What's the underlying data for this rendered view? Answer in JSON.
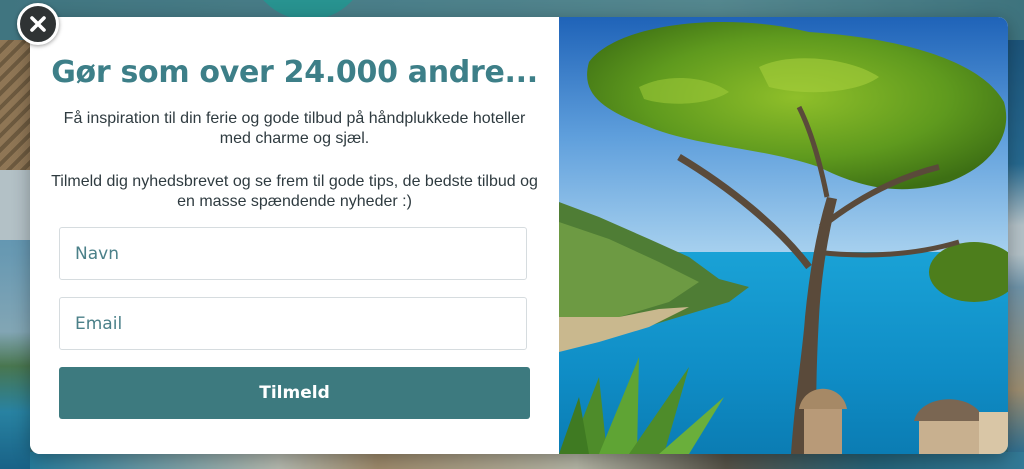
{
  "popup": {
    "title": "Gør som over 24.000 andre...",
    "paragraph_1": "Få inspiration til din ferie og gode tilbud på håndplukkede hoteller med charme og sjæl.",
    "paragraph_2": "Tilmeld dig nyhedsbrevet og se frem til gode tips, de bedste tilbud og en masse spændende nyheder :)",
    "name_field": {
      "placeholder": "Navn",
      "value": ""
    },
    "email_field": {
      "placeholder": "Email",
      "value": ""
    },
    "submit_label": "Tilmeld",
    "close_icon": "close-icon",
    "accent_color": "#3d7a7f",
    "title_color": "#3d7f88"
  },
  "image": {
    "subject": "umbrella-pine-over-coastal-bay"
  }
}
